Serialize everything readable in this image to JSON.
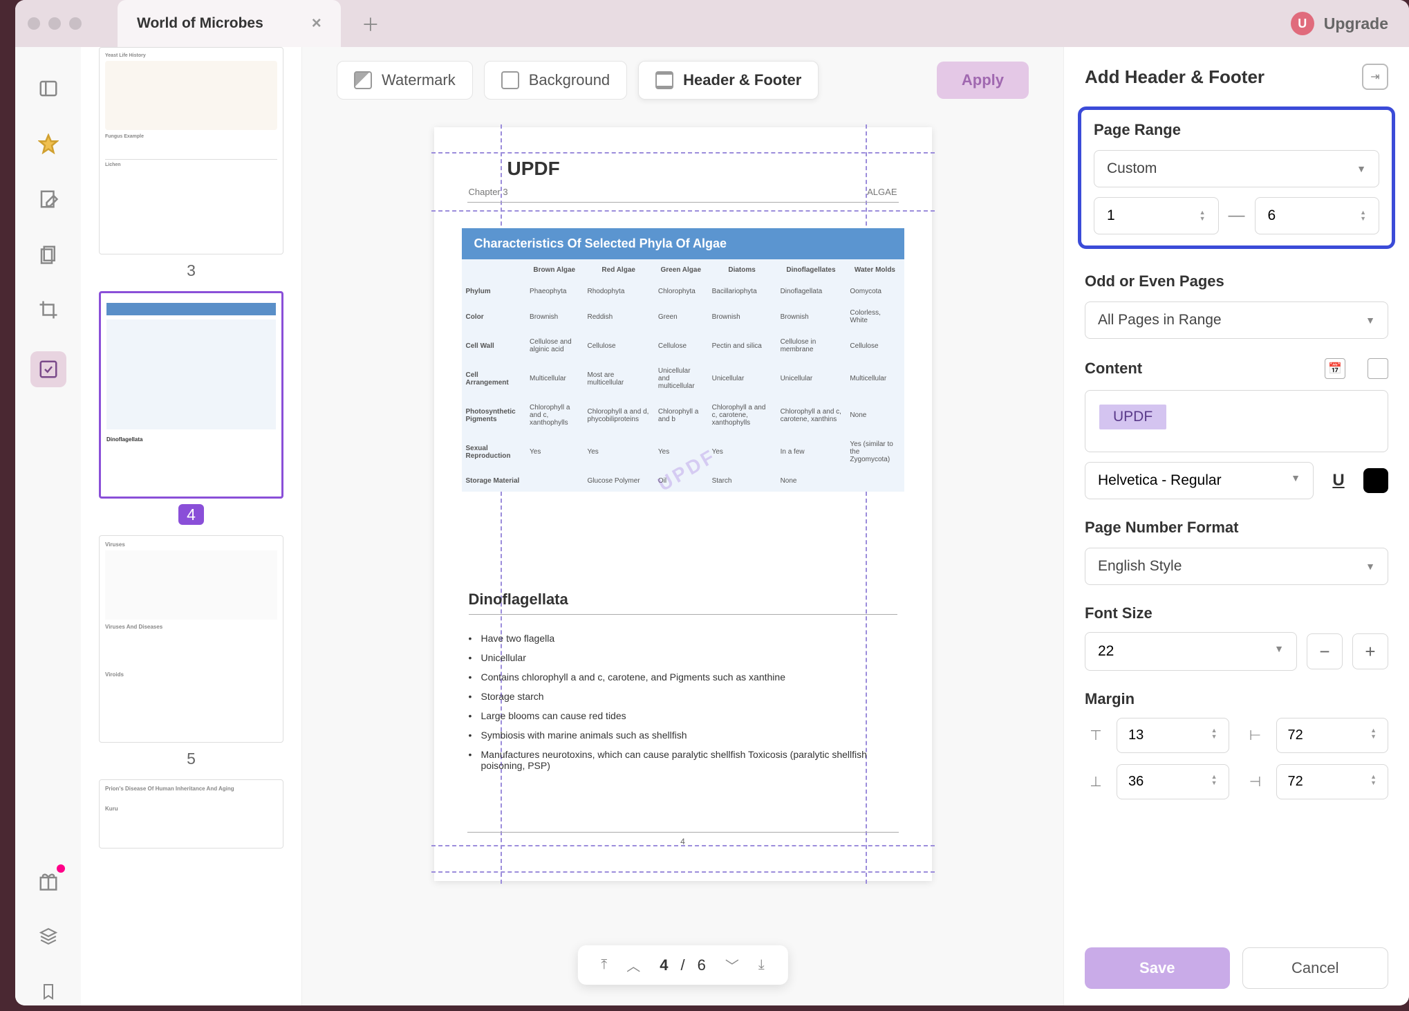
{
  "tab": {
    "title": "World of Microbes"
  },
  "upgrade": {
    "initial": "U",
    "label": "Upgrade"
  },
  "topTabs": {
    "watermark": "Watermark",
    "background": "Background",
    "headerFooter": "Header & Footer",
    "apply": "Apply"
  },
  "thumbnails": [
    {
      "num": "3"
    },
    {
      "num": "4",
      "selected": true
    },
    {
      "num": "5"
    }
  ],
  "page": {
    "headerLeft": "UPDF",
    "chapter": "Chapter 3",
    "algaeLabel": "ALGAE",
    "tableTitle": "Characteristics Of Selected Phyla Of Algae",
    "columns": [
      "",
      "Brown Algae",
      "Red Algae",
      "Green Algae",
      "Diatoms",
      "Dinoflagellates",
      "Water Molds"
    ],
    "rows": [
      [
        "Phylum",
        "Phaeophyta",
        "Rhodophyta",
        "Chlorophyta",
        "Bacillariophyta",
        "Dinoflagellata",
        "Oomycota"
      ],
      [
        "Color",
        "Brownish",
        "Reddish",
        "Green",
        "Brownish",
        "Brownish",
        "Colorless, White"
      ],
      [
        "Cell Wall",
        "Cellulose and alginic acid",
        "Cellulose",
        "Cellulose",
        "Pectin and silica",
        "Cellulose in membrane",
        "Cellulose"
      ],
      [
        "Cell Arrangement",
        "Multicellular",
        "Most are multicellular",
        "Unicellular and multicellular",
        "Unicellular",
        "Unicellular",
        "Multicellular"
      ],
      [
        "Photosynthetic Pigments",
        "Chlorophyll a and c, xanthophylls",
        "Chlorophyll a and d, phycobiliproteins",
        "Chlorophyll a and b",
        "Chlorophyll a and c, carotene, xanthophylls",
        "Chlorophyll a and c, carotene, xanthins",
        "None"
      ],
      [
        "Sexual Reproduction",
        "Yes",
        "Yes",
        "Yes",
        "Yes",
        "In a few",
        "Yes (similar to the Zygomycota)"
      ],
      [
        "Storage Material",
        "",
        "Glucose Polymer",
        "Oil",
        "Starch",
        "None",
        ""
      ]
    ],
    "watermark": "UPDF",
    "dinoTitle": "Dinoflagellata",
    "dinoItems": [
      "Have two flagella",
      "Unicellular",
      "Contains chlorophyll a and c, carotene, and Pigments such as xanthine",
      "Storage starch",
      "Large blooms can cause red tides",
      "Symbiosis with marine animals such as shellfish",
      "Manufactures neurotoxins, which can cause paralytic shellfish Toxicosis (paralytic shellfish poisoning, PSP)"
    ],
    "pageNum": "4"
  },
  "nav": {
    "current": "4",
    "sep": "/",
    "total": "6"
  },
  "rightPanel": {
    "title": "Add Header & Footer",
    "pageRange": {
      "label": "Page Range",
      "mode": "Custom",
      "from": "1",
      "to": "6"
    },
    "oddEven": {
      "label": "Odd or Even Pages",
      "value": "All Pages in Range"
    },
    "content": {
      "label": "Content",
      "tag": "UPDF"
    },
    "font": {
      "family": "Helvetica - Regular"
    },
    "pageNumFormat": {
      "label": "Page Number Format",
      "value": "English Style"
    },
    "fontSize": {
      "label": "Font Size",
      "value": "22"
    },
    "margin": {
      "label": "Margin",
      "top": "13",
      "bottom": "36",
      "left": "72",
      "right": "72"
    },
    "save": "Save",
    "cancel": "Cancel"
  }
}
